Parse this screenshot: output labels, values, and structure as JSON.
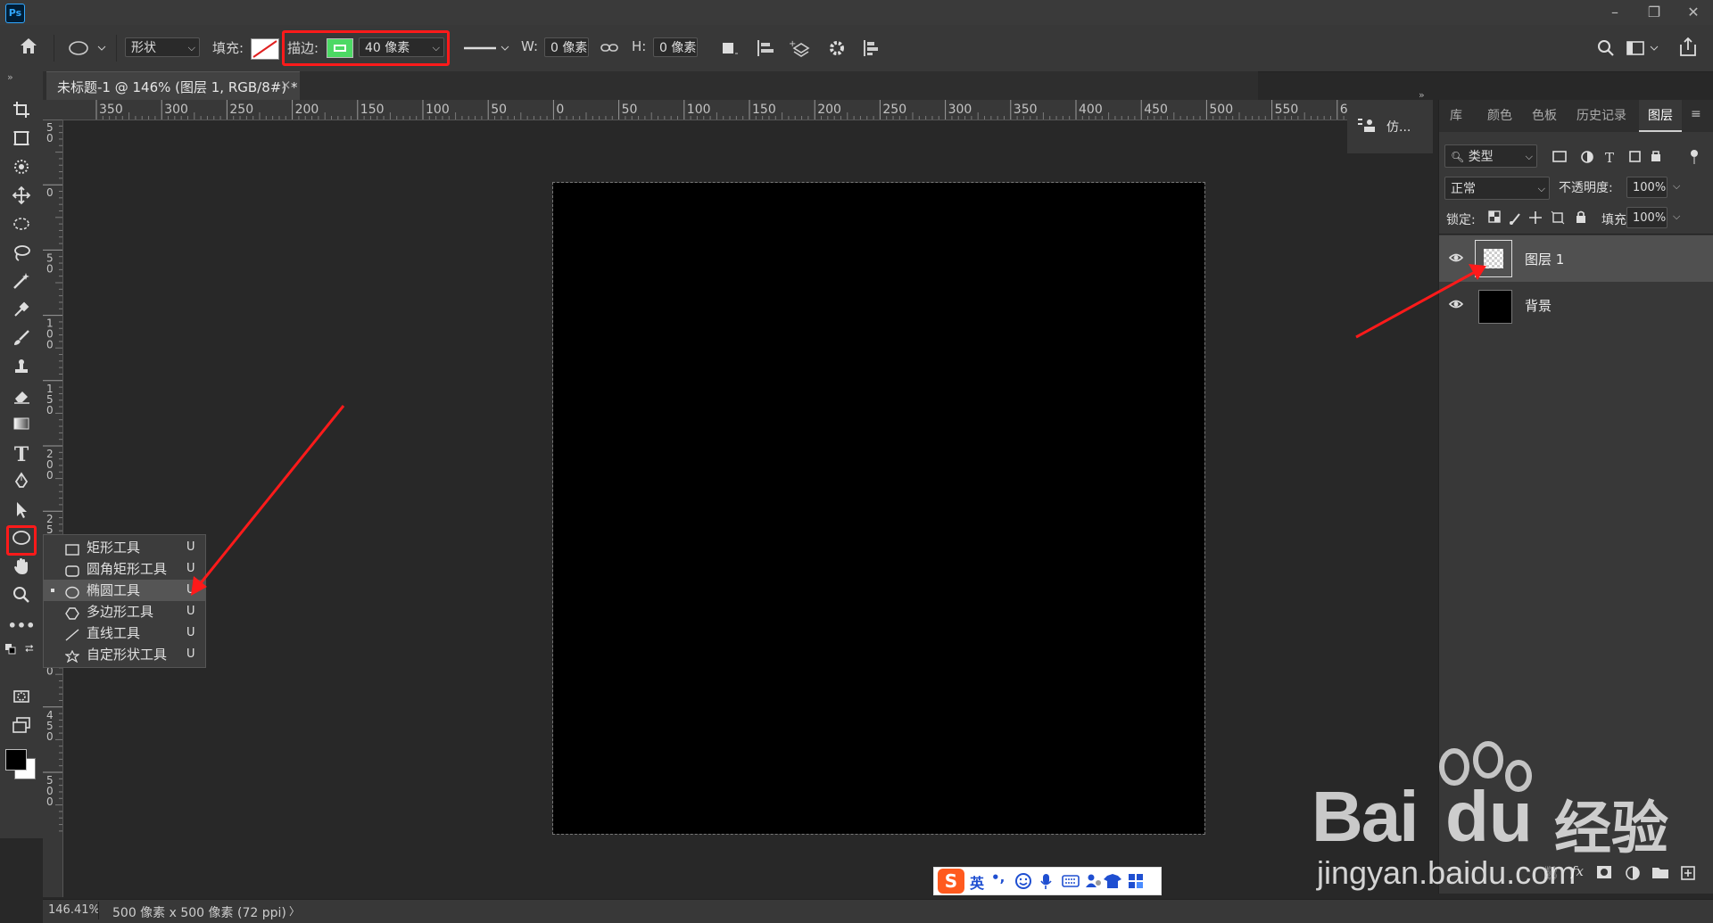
{
  "app": {
    "logo": "Ps"
  },
  "window_controls": [
    "–",
    "❐",
    "✕"
  ],
  "options_bar": {
    "shape_mode": "形状",
    "fill_label": "填充:",
    "stroke_label": "描边:",
    "stroke_color": "#4cd964",
    "stroke_width": "40 像素",
    "w_label": "W:",
    "w_value": "0 像素",
    "h_label": "H:",
    "h_value": "0 像素"
  },
  "document": {
    "tab_title": "未标题-1 @ 146% (图层 1, RGB/8#) *",
    "close": "×"
  },
  "rulers": {
    "h_ticks": [
      "350",
      "300",
      "250",
      "200",
      "150",
      "100",
      "50",
      "0",
      "50",
      "100",
      "150",
      "200",
      "250",
      "300",
      "350",
      "400",
      "450",
      "500",
      "550",
      "6"
    ],
    "v_ticks": [
      "5\n0",
      "0",
      "5\n0",
      "1\n0\n0",
      "1\n5\n0",
      "2\n0\n0",
      "2\n5",
      "0",
      "4\n0\n0",
      "4\n5\n0",
      "5\n0\n0"
    ]
  },
  "tool_flyout": [
    {
      "label": "矩形工具",
      "key": "U",
      "icon": "rectangle-icon",
      "selected": false
    },
    {
      "label": "圆角矩形工具",
      "key": "U",
      "icon": "rounded-rectangle-icon",
      "selected": false
    },
    {
      "label": "椭圆工具",
      "key": "U",
      "icon": "ellipse-icon",
      "selected": true
    },
    {
      "label": "多边形工具",
      "key": "U",
      "icon": "polygon-icon",
      "selected": false
    },
    {
      "label": "直线工具",
      "key": "U",
      "icon": "line-icon",
      "selected": false
    },
    {
      "label": "自定形状工具",
      "key": "U",
      "icon": "custom-shape-icon",
      "selected": false
    }
  ],
  "mini_panel": {
    "label": "仿..."
  },
  "panel_tabs": [
    "库",
    "颜色",
    "色板",
    "历史记录",
    "图层"
  ],
  "layers_panel": {
    "filter_label": "类型",
    "blend_mode": "正常",
    "opacity_label": "不透明度:",
    "opacity_value": "100%",
    "lock_label": "锁定:",
    "fill_label": "填充:",
    "fill_value": "100%",
    "layers": [
      {
        "name": "图层 1",
        "thumb": "transparent",
        "selected": true
      },
      {
        "name": "背景",
        "thumb": "#000000",
        "selected": false
      }
    ]
  },
  "status": {
    "zoom": "146.41%",
    "doc_info": "500 像素 x 500 像素 (72 ppi)",
    "arrow": "〉"
  },
  "ime": {
    "mode": "英",
    "punct": "•,"
  },
  "watermark": {
    "brand": "Bai",
    "brand2": "du",
    "cn": "经验",
    "url": "jingyan.baidu.com"
  },
  "colors": {
    "highlight": "#ff1a1a",
    "accent": "#31a8ff"
  }
}
